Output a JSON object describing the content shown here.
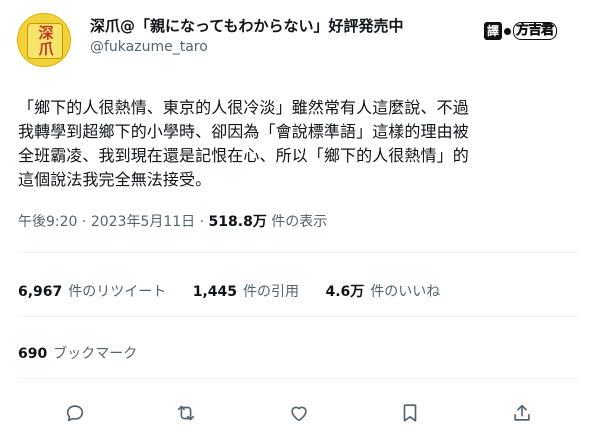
{
  "author": {
    "display_name": "深爪@「親になってもわからない」好評発売中",
    "handle": "@fukazume_taro",
    "avatar_text": "深爪"
  },
  "translator_badge": {
    "seal": "譯",
    "name": "方吉君"
  },
  "tweet": {
    "lines": [
      "「鄉下的人很熱情、東京的人很冷淡」雖然常有人這麼說、不過",
      "我轉學到超鄉下的小學時、卻因為「會說標準語」這樣的理由被",
      "全班霸凌、我到現在還是記恨在心、所以「鄉下的人很熱情」的",
      "這個說法我完全無法接受。"
    ]
  },
  "meta": {
    "time": "午後9:20",
    "separator": "·",
    "date": "2023年5月11日",
    "views_count": "518.8万",
    "views_label": "件の表示"
  },
  "stats": {
    "retweets": {
      "count": "6,967",
      "label": "件のリツイート"
    },
    "quotes": {
      "count": "1,445",
      "label": "件の引用"
    },
    "likes": {
      "count": "4.6万",
      "label": "件のいいね"
    }
  },
  "bookmarks": {
    "count": "690",
    "label": "ブックマーク"
  },
  "actions": [
    "reply-icon",
    "retweet-icon",
    "like-icon",
    "bookmark-icon",
    "share-icon"
  ],
  "colors": {
    "text": "#0f1419",
    "secondary": "#536471",
    "divider": "#eff3f4"
  }
}
